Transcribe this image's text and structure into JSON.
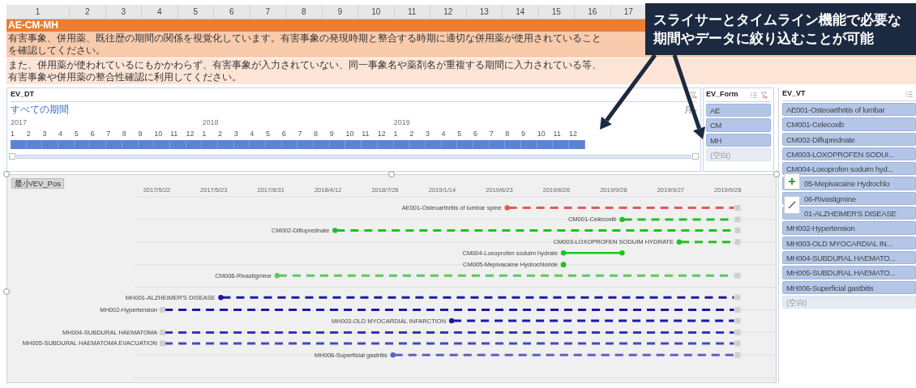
{
  "column_headers": [
    "1",
    "2",
    "3",
    "4",
    "5",
    "6",
    "7",
    "8",
    "9",
    "10",
    "11",
    "12",
    "13",
    "14",
    "15",
    "16",
    "17"
  ],
  "title": "AE-CM-MH",
  "description_lines": [
    "有害事象、併用薬、既往歴の期間の関係を視覚化しています。有害事象の発現時期と整合する時期に適切な併用薬が使用されていることを確認してください。",
    "また、併用薬が使われているにもかかわらず、有害事象が入力されていない、同一事象名や薬剤名が重複する期間に入力されている等、有害事象や併用薬の整合性確認に利用してください。"
  ],
  "timeline": {
    "title": "EV_DT",
    "period_label": "すべての期間",
    "level_label": "月 -",
    "years": [
      {
        "label": "2017",
        "months": [
          {
            "label": "1",
            "selected": true
          },
          {
            "label": "2",
            "selected": true
          },
          {
            "label": "3",
            "selected": true
          },
          {
            "label": "4",
            "selected": true
          },
          {
            "label": "5",
            "selected": true
          },
          {
            "label": "6",
            "selected": true
          },
          {
            "label": "7",
            "selected": true
          },
          {
            "label": "8",
            "selected": true
          },
          {
            "label": "9",
            "selected": true
          },
          {
            "label": "10",
            "selected": true
          },
          {
            "label": "11",
            "selected": true
          },
          {
            "label": "12",
            "selected": true
          }
        ]
      },
      {
        "label": "2018",
        "months": [
          {
            "label": "1",
            "selected": true
          },
          {
            "label": "2",
            "selected": true
          },
          {
            "label": "3",
            "selected": true
          },
          {
            "label": "4",
            "selected": true
          },
          {
            "label": "5",
            "selected": true
          },
          {
            "label": "6",
            "selected": true
          },
          {
            "label": "7",
            "selected": true
          },
          {
            "label": "8",
            "selected": true
          },
          {
            "label": "9",
            "selected": true
          },
          {
            "label": "10",
            "selected": true
          },
          {
            "label": "11",
            "selected": true
          },
          {
            "label": "12",
            "selected": true
          }
        ]
      },
      {
        "label": "2019",
        "months": [
          {
            "label": "1",
            "selected": true
          },
          {
            "label": "2",
            "selected": true
          },
          {
            "label": "3",
            "selected": true
          },
          {
            "label": "4",
            "selected": true
          },
          {
            "label": "5",
            "selected": true
          },
          {
            "label": "6",
            "selected": true
          },
          {
            "label": "7",
            "selected": true
          },
          {
            "label": "8",
            "selected": true
          },
          {
            "label": "9",
            "selected": true
          },
          {
            "label": "10",
            "selected": true
          },
          {
            "label": "11",
            "selected": true
          },
          {
            "label": "12",
            "selected": true
          }
        ]
      }
    ]
  },
  "form_slicer": {
    "title": "EV_Form",
    "items": [
      {
        "label": "AE",
        "selected": true
      },
      {
        "label": "CM",
        "selected": true
      },
      {
        "label": "MH",
        "selected": true
      },
      {
        "label": "(空白)",
        "selected": false
      }
    ]
  },
  "vt_slicer": {
    "title": "EV_VT",
    "items": [
      {
        "label": "AE001-Osteoarthritis of lumbar",
        "selected": true
      },
      {
        "label": "CM001-Celecoxib",
        "selected": true
      },
      {
        "label": "CM002-Difluprednate",
        "selected": true
      },
      {
        "label": "CM003-LOXOPROFEN SODUI...",
        "selected": true
      },
      {
        "label": "CM004-Loxoprofen soduim hyd...",
        "selected": true
      },
      {
        "label": "05-Mepivacaine Hydrochlo",
        "selected": true
      },
      {
        "label": "06-Rivastigmine",
        "selected": true
      },
      {
        "label": "01-ALZHEIMER'S DISEASE",
        "selected": true
      },
      {
        "label": "MH002-Hypertension",
        "selected": true
      },
      {
        "label": "MH003-OLD MYOCARDIAL IN...",
        "selected": true
      },
      {
        "label": "MH004-SUBDURAL HAEMATO...",
        "selected": true
      },
      {
        "label": "MH005-SUBDURAL HAEMATO...",
        "selected": true
      },
      {
        "label": "MH006-Superficial gastbitis",
        "selected": true
      },
      {
        "label": "(空白)",
        "selected": false
      }
    ]
  },
  "chart": {
    "field_button": "最小/EV_Pos",
    "axis_labels": [
      "2017/5/22",
      "2017/5/23",
      "2017/8/31",
      "2018/4/12",
      "2018/7/26",
      "2019/1/14",
      "2019/6/23",
      "2019/6/26",
      "2019/9/26",
      "2019/9/27",
      "2019/9/28"
    ],
    "rows": [
      {
        "label": "AE001-Osteoarthritis of lumbar spine",
        "kind": "ongoing",
        "color": "#e05a5a"
      },
      {
        "label": "CM001-Celecoxib",
        "kind": "ongoing",
        "color": "#22c022"
      },
      {
        "label": "CM002-Difluprednate",
        "kind": "ongoing",
        "color": "#22c022"
      },
      {
        "label": "CM003-LOXOPROFEN SODUIM HYDRATE",
        "kind": "ongoing",
        "color": "#22c022"
      },
      {
        "label": "CM004-Loxoprofen soduim hydrate",
        "kind": "period",
        "color": "#22c022"
      },
      {
        "label": "CM005-Mepivacaine Hydrochloride",
        "kind": "point",
        "color": "#22c022"
      },
      {
        "label": "CM006-Rivastigmine",
        "kind": "ongoing",
        "color": "#5cc85c"
      },
      {
        "label": "MH001-ALZHEIMER'S DISEASE",
        "kind": "ongoing",
        "color": "#1a1aa8"
      },
      {
        "label": "MH002-Hypertension",
        "kind": "ongoing_no_start",
        "color": "#1a1aa8"
      },
      {
        "label": "MH003-OLD MYOCARDIAL INFARCTION",
        "kind": "ongoing",
        "color": "#1a1aa8"
      },
      {
        "label": "MH004-SUBDURAL HAEMATOMA",
        "kind": "ongoing_no_start",
        "color": "#3535b8"
      },
      {
        "label": "MH005-SUBDURAL HAEMATOMA EVACUATION",
        "kind": "ongoing_no_start",
        "color": "#4848c0"
      },
      {
        "label": "MH006-Superficial gastritis",
        "kind": "ongoing",
        "color": "#6060c8"
      }
    ]
  },
  "callout": {
    "lines": [
      "スライサーとタイムライン機能で必要な",
      "期間やデータに絞り込むことが可能"
    ]
  }
}
